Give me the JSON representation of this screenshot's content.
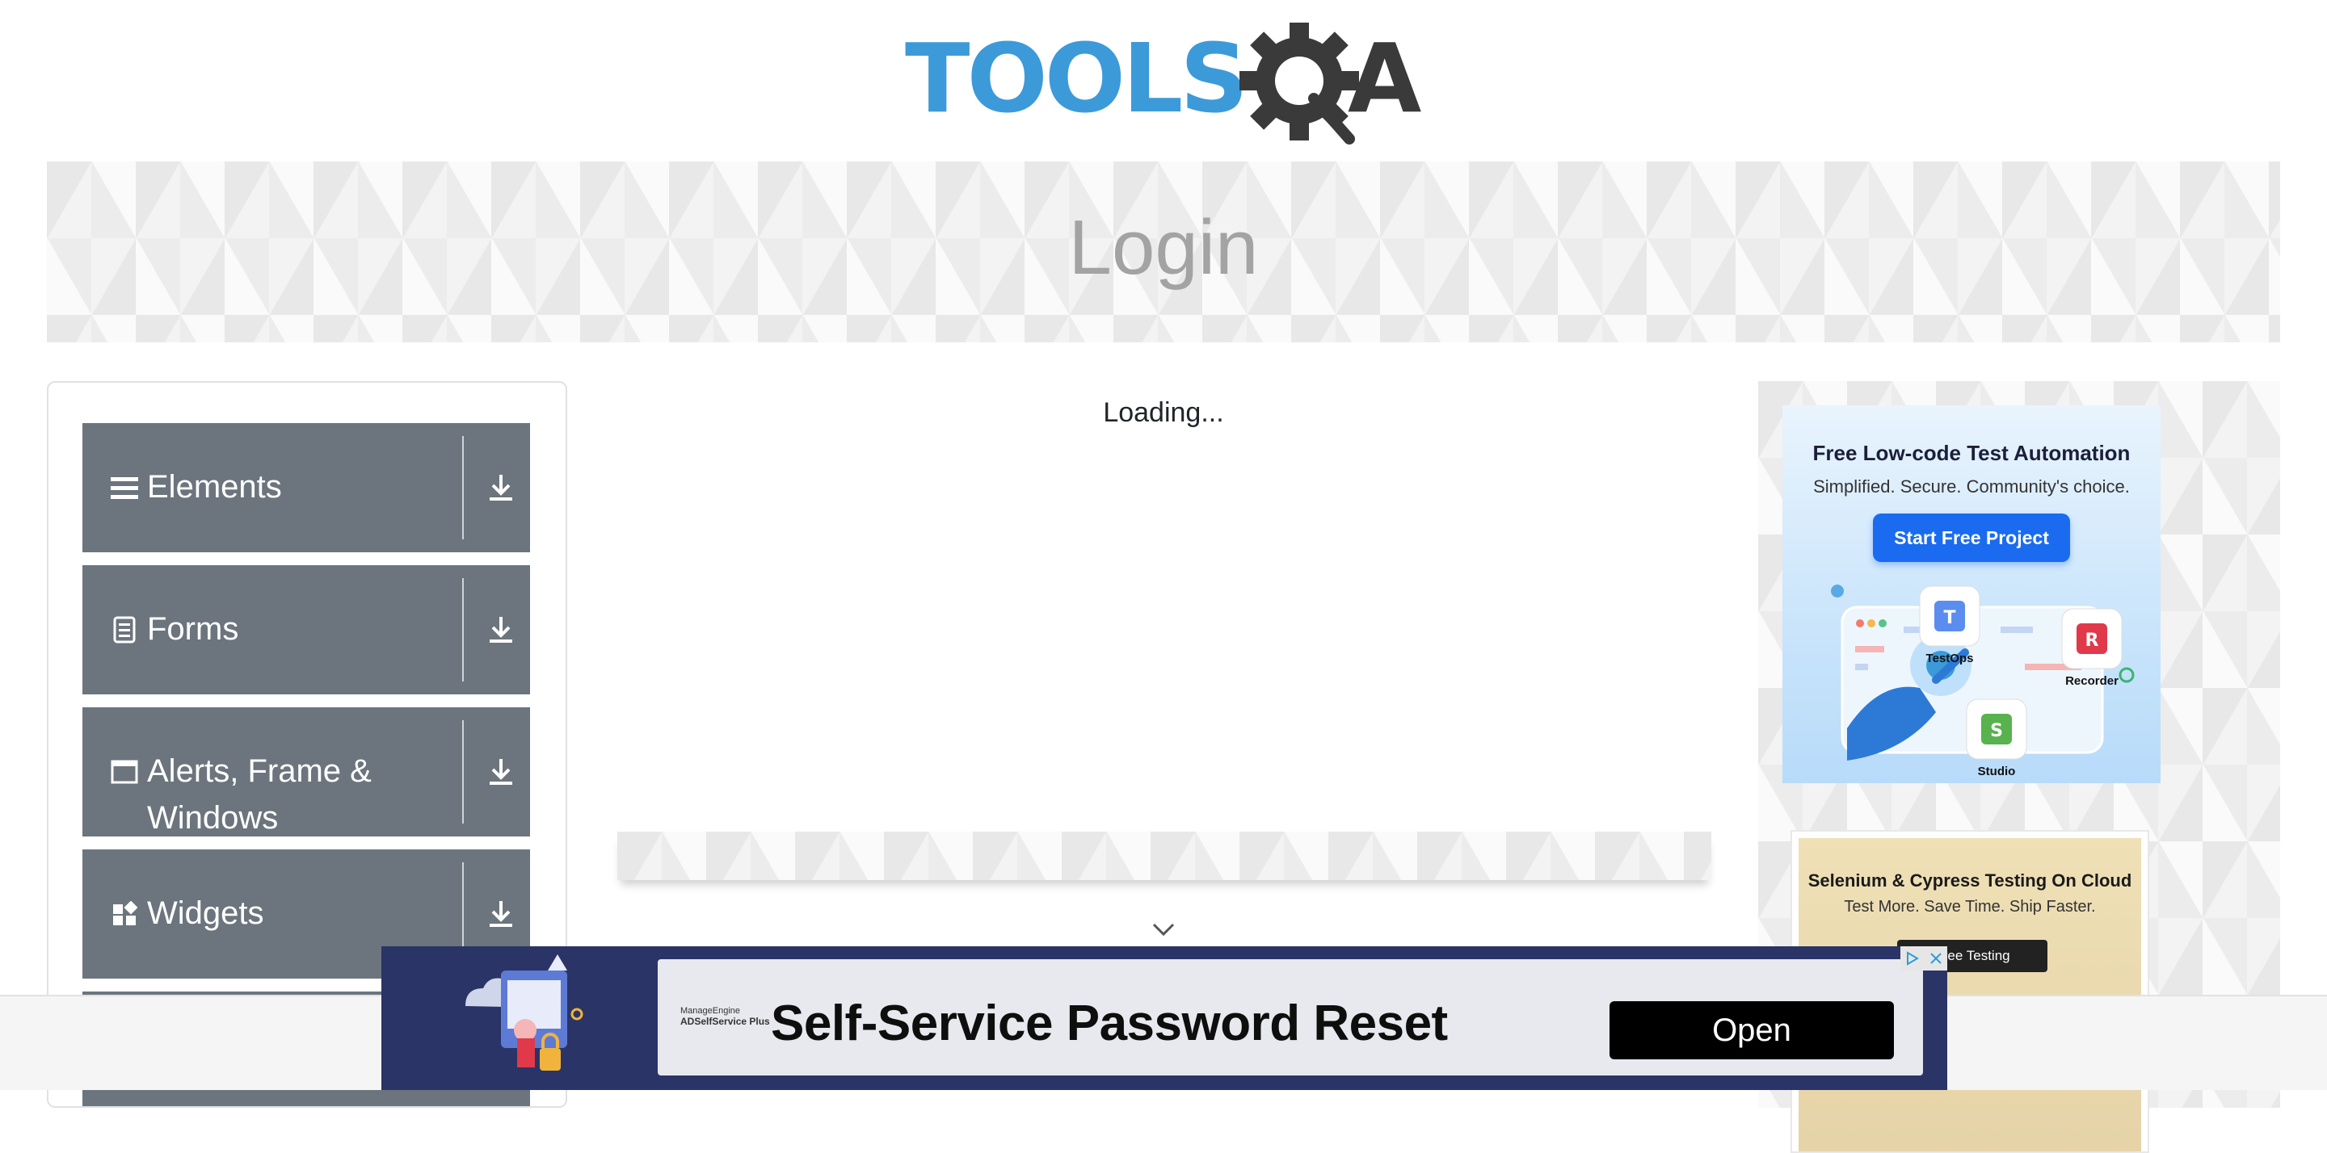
{
  "header": {
    "logo_alt": "TOOLSQA",
    "logo_text_left": "TOOLS",
    "logo_text_right": "A",
    "logo_color": "#3d9ad9"
  },
  "banner": {
    "title": "Login"
  },
  "sidebar": {
    "groups": [
      {
        "label": "Elements",
        "icon": "hamburger-icon"
      },
      {
        "label": "Forms",
        "icon": "document-icon"
      },
      {
        "label": "Alerts, Frame & Windows",
        "icon": "window-icon"
      },
      {
        "label": "Widgets",
        "icon": "widgets-icon"
      }
    ],
    "group_color": "#6c757d"
  },
  "main": {
    "loading_text": "Loading..."
  },
  "ads": {
    "katalon": {
      "title": "Free Low-code Test Automation",
      "subtitle": "Simplified. Secure. Community's choice.",
      "button": "Start Free Project",
      "products": [
        "TestOps",
        "Recorder",
        "Studio"
      ]
    },
    "cloud": {
      "title": "Selenium & Cypress Testing On Cloud",
      "subtitle": "Test More. Save Time. Ship Faster.",
      "button": "Free Testing"
    },
    "bottom": {
      "brand_line1": "ManageEngine",
      "brand_line2": "ADSelfService Plus",
      "title": "Self-Service Password Reset",
      "button": "Open"
    }
  }
}
